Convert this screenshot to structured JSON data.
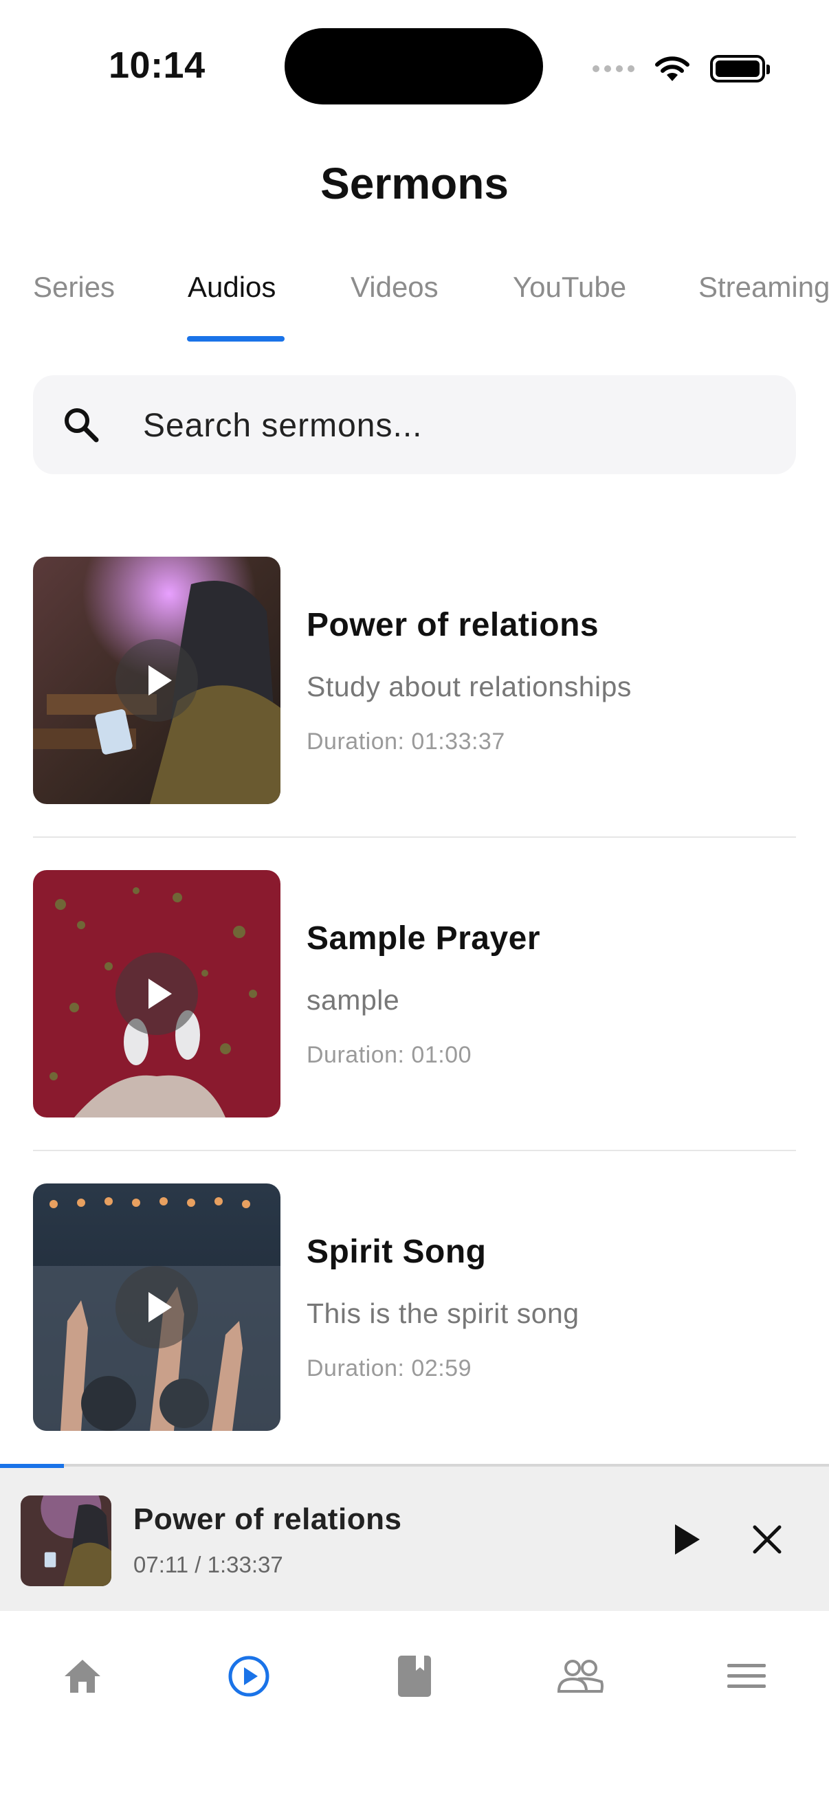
{
  "status_bar": {
    "time": "10:14"
  },
  "page": {
    "title": "Sermons"
  },
  "tabs": [
    {
      "label": "Series",
      "active": false
    },
    {
      "label": "Audios",
      "active": true
    },
    {
      "label": "Videos",
      "active": false
    },
    {
      "label": "YouTube",
      "active": false
    },
    {
      "label": "Streaming",
      "active": false
    }
  ],
  "search": {
    "placeholder": "Search sermons...",
    "value": "",
    "icon": "search-icon"
  },
  "sermons": [
    {
      "title": "Power of relations",
      "subtitle": "Study about relationships",
      "duration": "Duration: 01:33:37"
    },
    {
      "title": "Sample Prayer",
      "subtitle": "sample",
      "duration": "Duration: 01:00"
    },
    {
      "title": "Spirit Song",
      "subtitle": "This is the spirit song",
      "duration": "Duration: 02:59"
    }
  ],
  "player": {
    "title": "Power of relations",
    "time": "07:11 / 1:33:37",
    "progress_fraction": 0.077
  },
  "nav": [
    {
      "icon": "home-icon",
      "active": false
    },
    {
      "icon": "play-circle-icon",
      "active": true
    },
    {
      "icon": "book-icon",
      "active": false
    },
    {
      "icon": "people-icon",
      "active": false
    },
    {
      "icon": "menu-icon",
      "active": false
    }
  ],
  "colors": {
    "accent": "#1a73e8",
    "inactive_icon": "#8e8e8e"
  }
}
